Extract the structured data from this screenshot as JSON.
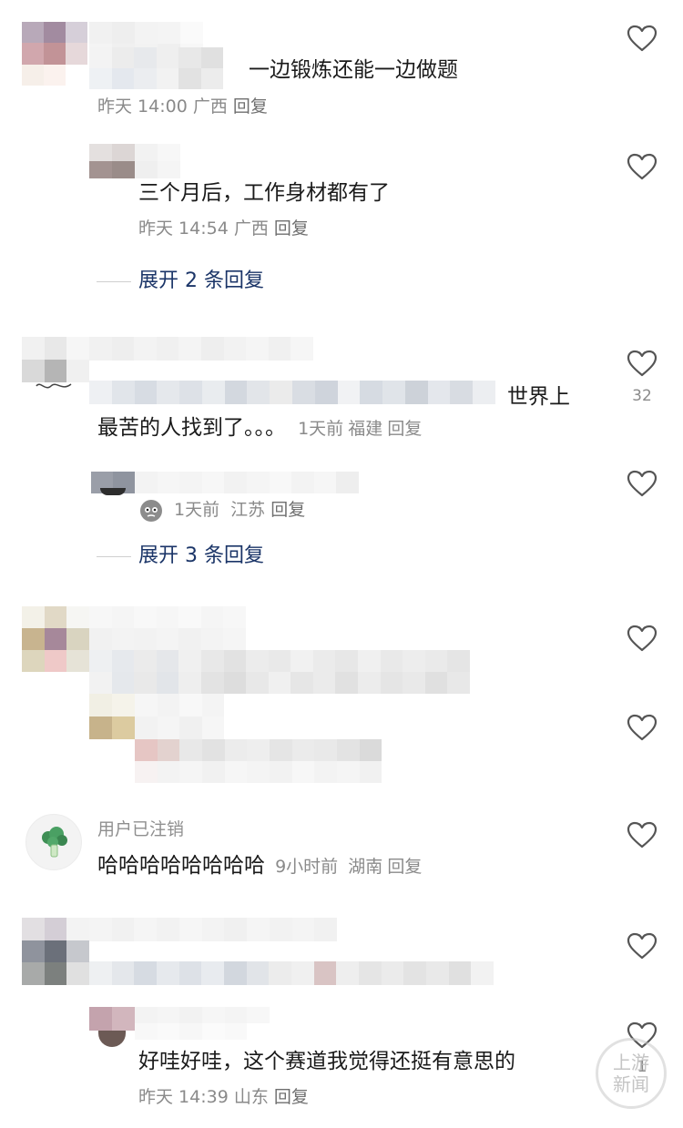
{
  "comments": [
    {
      "text": "一边锻炼还能一边做题",
      "time": "昨天 14:00",
      "location": "广西",
      "reply_label": "回复"
    },
    {
      "text": "三个月后，工作身材都有了",
      "time": "昨天 14:54",
      "location": "广西",
      "reply_label": "回复"
    },
    {
      "text_suffix": "世界上",
      "text_line2": "最苦的人找到了。。。",
      "time": "1天前",
      "location": "福建",
      "reply_label": "回复",
      "likes": "32"
    },
    {
      "time": "1天前",
      "location": "江苏",
      "reply_label": "回复"
    },
    {
      "username": "用户已注销",
      "text": "哈哈哈哈哈哈哈哈",
      "time": "9小时前",
      "location": "湖南",
      "reply_label": "回复"
    },
    {
      "text": "好哇好哇，这个赛道我觉得还挺有意思的",
      "time": "昨天 14:39",
      "location": "山东",
      "reply_label": "回复",
      "likes": "1"
    }
  ],
  "expand": [
    "展开 2 条回复",
    "展开 3 条回复"
  ],
  "watermark": {
    "line1": "上游",
    "line2": "新闻"
  },
  "colors": {
    "link_blue": "#1b3568",
    "meta_gray": "#8a8a8a"
  }
}
